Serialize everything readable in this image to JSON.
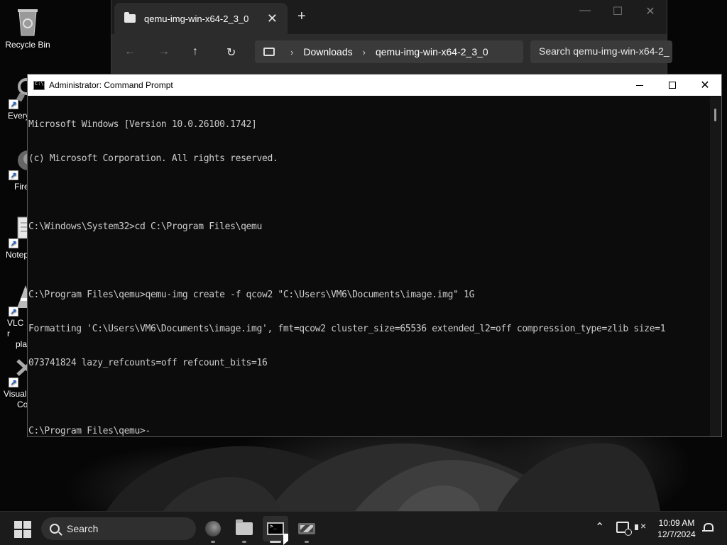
{
  "desktop": {
    "icons": [
      {
        "label": "Recycle Bin",
        "icon": "recycle-bin-icon",
        "shortcut": false
      },
      {
        "label": "Every",
        "icon": "everything-icon",
        "shortcut": true
      },
      {
        "label": "Fire",
        "icon": "firefox-icon",
        "shortcut": true
      },
      {
        "label": "Notep",
        "icon": "notepad-icon",
        "shortcut": true
      },
      {
        "label": "VLC r",
        "label2": "pla",
        "icon": "vlc-icon",
        "shortcut": true
      },
      {
        "label": "Visual",
        "label2": "Co",
        "icon": "vscode-icon",
        "shortcut": true
      }
    ]
  },
  "explorer": {
    "tab_title": "qemu-img-win-x64-2_3_0",
    "tab_close": "✕",
    "new_tab": "+",
    "breadcrumb": [
      "Downloads",
      "qemu-img-win-x64-2_3_0"
    ],
    "search_placeholder": "Search qemu-img-win-x64-2_",
    "nav": {
      "back": "←",
      "forward": "→",
      "up": "↑",
      "refresh": "↻"
    }
  },
  "cmd": {
    "title": "Administrator: Command Prompt",
    "lines": [
      "Microsoft Windows [Version 10.0.26100.1742]",
      "(c) Microsoft Corporation. All rights reserved.",
      "",
      "C:\\Windows\\System32>cd C:\\Program Files\\qemu",
      "",
      "C:\\Program Files\\qemu>qemu-img create -f qcow2 \"C:\\Users\\VM6\\Documents\\image.img\" 1G",
      "Formatting 'C:\\Users\\VM6\\Documents\\image.img', fmt=qcow2 cluster_size=65536 extended_l2=off compression_type=zlib size=1",
      "073741824 lazy_refcounts=off refcount_bits=16",
      "",
      "C:\\Program Files\\qemu>-"
    ]
  },
  "taskbar": {
    "search_label": "Search",
    "apps": [
      "firefox-icon",
      "file-explorer-icon",
      "command-prompt-icon",
      "virtual-machine-icon"
    ],
    "active_app": "command-prompt-icon",
    "time": "10:09 AM",
    "date": "12/7/2024"
  }
}
